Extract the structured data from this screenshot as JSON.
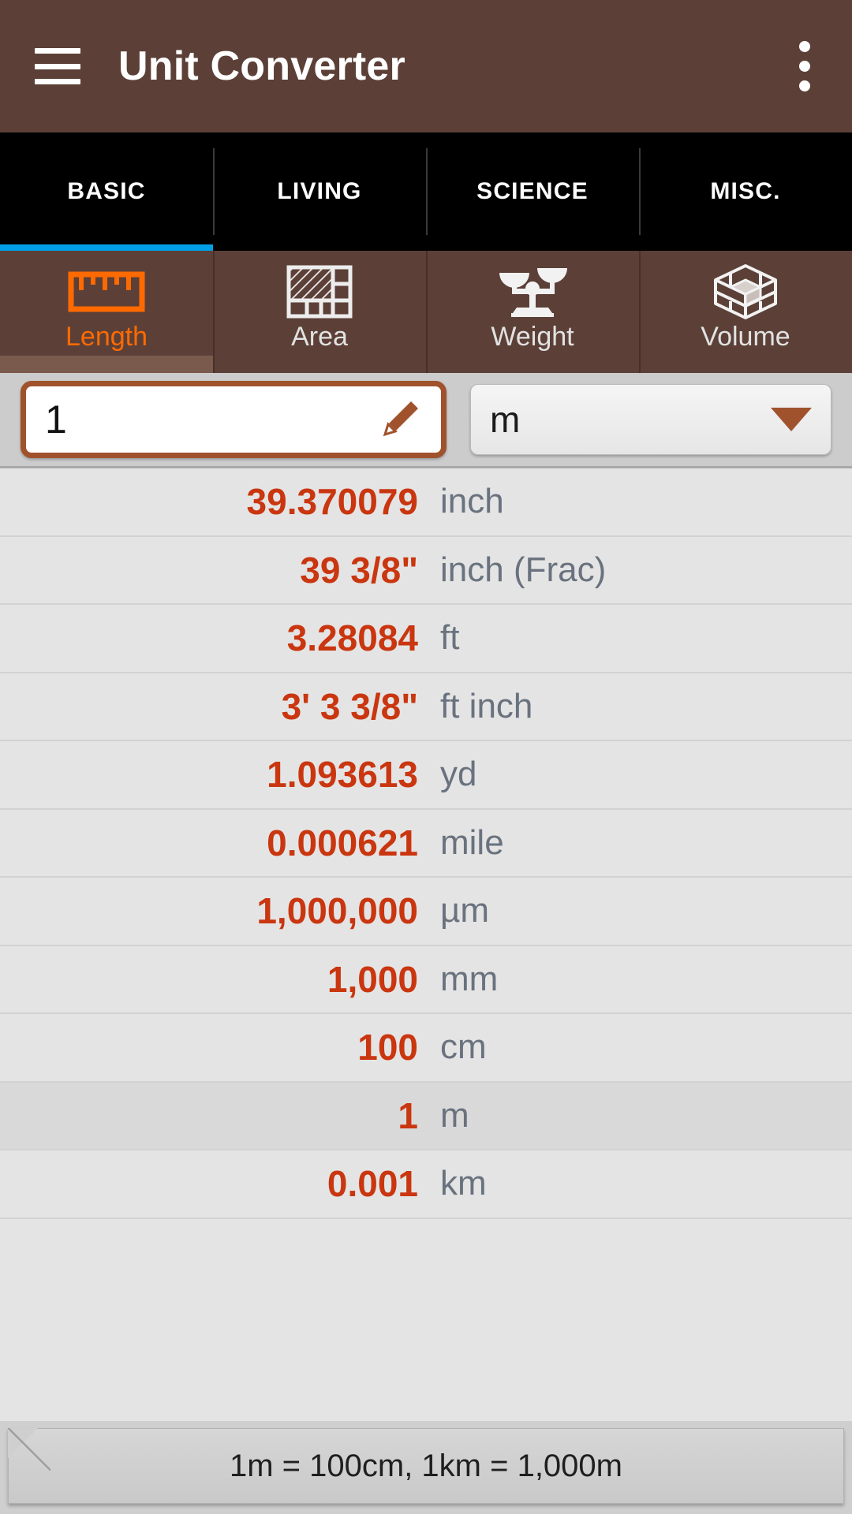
{
  "appbar": {
    "title": "Unit Converter",
    "menu_icon": "hamburger-menu-icon",
    "overflow_icon": "more-vertical-icon"
  },
  "tabs": [
    {
      "label": "BASIC",
      "active": true
    },
    {
      "label": "LIVING",
      "active": false
    },
    {
      "label": "SCIENCE",
      "active": false
    },
    {
      "label": "MISC.",
      "active": false
    }
  ],
  "categories": [
    {
      "label": "Length",
      "icon": "ruler-icon",
      "active": true
    },
    {
      "label": "Area",
      "icon": "tiles-icon",
      "active": false
    },
    {
      "label": "Weight",
      "icon": "balance-scale-icon",
      "active": false
    },
    {
      "label": "Volume",
      "icon": "cube-icon",
      "active": false
    }
  ],
  "input": {
    "value": "1",
    "placeholder": "1",
    "edit_icon": "pencil-icon",
    "unit": "m",
    "caret_icon": "triangle-down-icon"
  },
  "results": [
    {
      "value": "39.370079",
      "unit": "inch",
      "highlight": false
    },
    {
      "value": "39 3/8\"",
      "unit": "inch (Frac)",
      "highlight": false
    },
    {
      "value": "3.28084",
      "unit": "ft",
      "highlight": false
    },
    {
      "value": "3' 3 3/8\"",
      "unit": "ft inch",
      "highlight": false
    },
    {
      "value": "1.093613",
      "unit": "yd",
      "highlight": false
    },
    {
      "value": "0.000621",
      "unit": "mile",
      "highlight": false
    },
    {
      "value": "1,000,000",
      "unit": "µm",
      "highlight": false
    },
    {
      "value": "1,000",
      "unit": "mm",
      "highlight": false
    },
    {
      "value": "100",
      "unit": "cm",
      "highlight": false
    },
    {
      "value": "1",
      "unit": "m",
      "highlight": true
    },
    {
      "value": "0.001",
      "unit": "km",
      "highlight": false
    }
  ],
  "footer": {
    "note": "1m = 100cm, 1km = 1,000m"
  },
  "colors": {
    "appbar": "#5c4038",
    "tabbar": "#000000",
    "tab_indicator": "#00a0e9",
    "category_active_text": "#ff6a00",
    "value_text": "#c9360f",
    "unit_text": "#69727e",
    "input_border": "#a0522d",
    "list_bg": "#e4e4e4"
  }
}
